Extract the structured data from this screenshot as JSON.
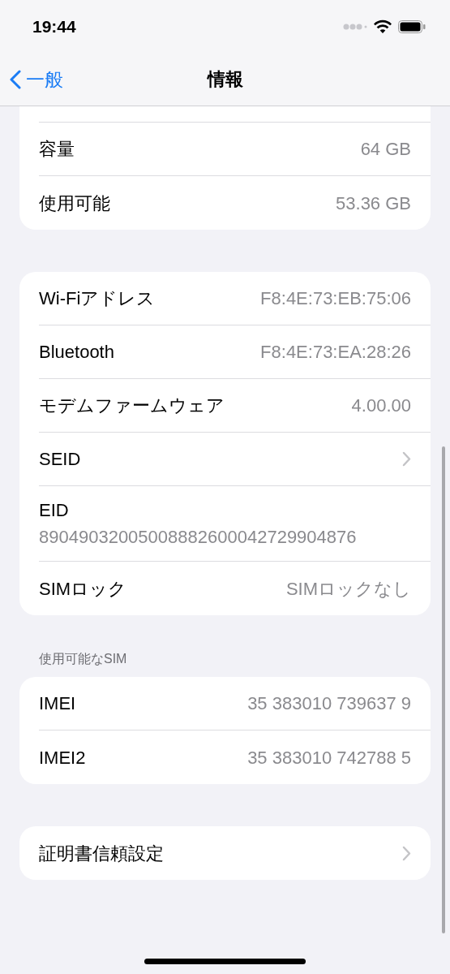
{
  "status_bar": {
    "time": "19:44"
  },
  "nav": {
    "back_label": "一般",
    "title": "情報"
  },
  "groups": [
    {
      "cut_top": true,
      "rows": [
        {
          "kind": "value",
          "label": "容量",
          "value": "64 GB"
        },
        {
          "kind": "value",
          "label": "使用可能",
          "value": "53.36 GB"
        }
      ]
    },
    {
      "rows": [
        {
          "kind": "value",
          "label": "Wi-Fiアドレス",
          "value": "F8:4E:73:EB:75:06"
        },
        {
          "kind": "value",
          "label": "Bluetooth",
          "value": "F8:4E:73:EA:28:26"
        },
        {
          "kind": "value",
          "label": "モデムファームウェア",
          "value": "4.00.00"
        },
        {
          "kind": "chevron",
          "label": "SEID"
        },
        {
          "kind": "stacked",
          "label": "EID",
          "value": "89049032005008882600042729904876"
        },
        {
          "kind": "value",
          "label": "SIMロック",
          "value": "SIMロックなし"
        }
      ]
    },
    {
      "header": "使用可能なSIM",
      "rows": [
        {
          "kind": "value",
          "label": "IMEI",
          "value": "35 383010 739637 9"
        },
        {
          "kind": "value",
          "label": "IMEI2",
          "value": "35 383010 742788 5"
        }
      ]
    },
    {
      "rows": [
        {
          "kind": "chevron",
          "label": "証明書信頼設定"
        }
      ]
    }
  ]
}
